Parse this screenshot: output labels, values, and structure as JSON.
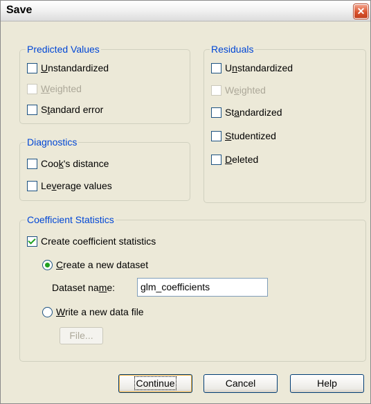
{
  "dialog": {
    "title": "Save",
    "close_glyph": "✕"
  },
  "predicted": {
    "legend": "Predicted Values",
    "items": [
      {
        "pre": "",
        "u": "U",
        "post": "nstandardized",
        "checked": false,
        "enabled": true
      },
      {
        "pre": "",
        "u": "W",
        "post": "eighted",
        "checked": false,
        "enabled": false
      },
      {
        "pre": "S",
        "u": "t",
        "post": "andard error",
        "checked": false,
        "enabled": true
      }
    ]
  },
  "diagnostics": {
    "legend": "Diagnostics",
    "items": [
      {
        "pre": "Coo",
        "u": "k",
        "post": "'s distance",
        "checked": false,
        "enabled": true
      },
      {
        "pre": "Le",
        "u": "v",
        "post": "erage values",
        "checked": false,
        "enabled": true
      }
    ]
  },
  "residuals": {
    "legend": "Residuals",
    "items": [
      {
        "pre": "U",
        "u": "n",
        "post": "standardized",
        "checked": false,
        "enabled": true
      },
      {
        "pre": "W",
        "u": "e",
        "post": "ighted",
        "checked": false,
        "enabled": false
      },
      {
        "pre": "St",
        "u": "a",
        "post": "ndardized",
        "checked": false,
        "enabled": true
      },
      {
        "pre": "",
        "u": "S",
        "post": "tudentized",
        "checked": false,
        "enabled": true
      },
      {
        "pre": "",
        "u": "D",
        "post": "eleted",
        "checked": false,
        "enabled": true
      }
    ]
  },
  "coefficient": {
    "legend": "Coefficient Statistics",
    "create_stats": {
      "pre": "",
      "u": "",
      "post": "Create coefficient statistics",
      "checked": true
    },
    "new_dataset": {
      "pre": "",
      "u": "C",
      "post": "reate a new dataset",
      "selected": true
    },
    "dataset_name": {
      "pre": "Dataset na",
      "u": "m",
      "post": "e:",
      "value": "glm_coefficients"
    },
    "new_file": {
      "pre": "",
      "u": "W",
      "post": "rite a new data file",
      "selected": false
    },
    "file_button": "File..."
  },
  "buttons": {
    "continue": "Continue",
    "cancel": "Cancel",
    "help": "Help"
  }
}
